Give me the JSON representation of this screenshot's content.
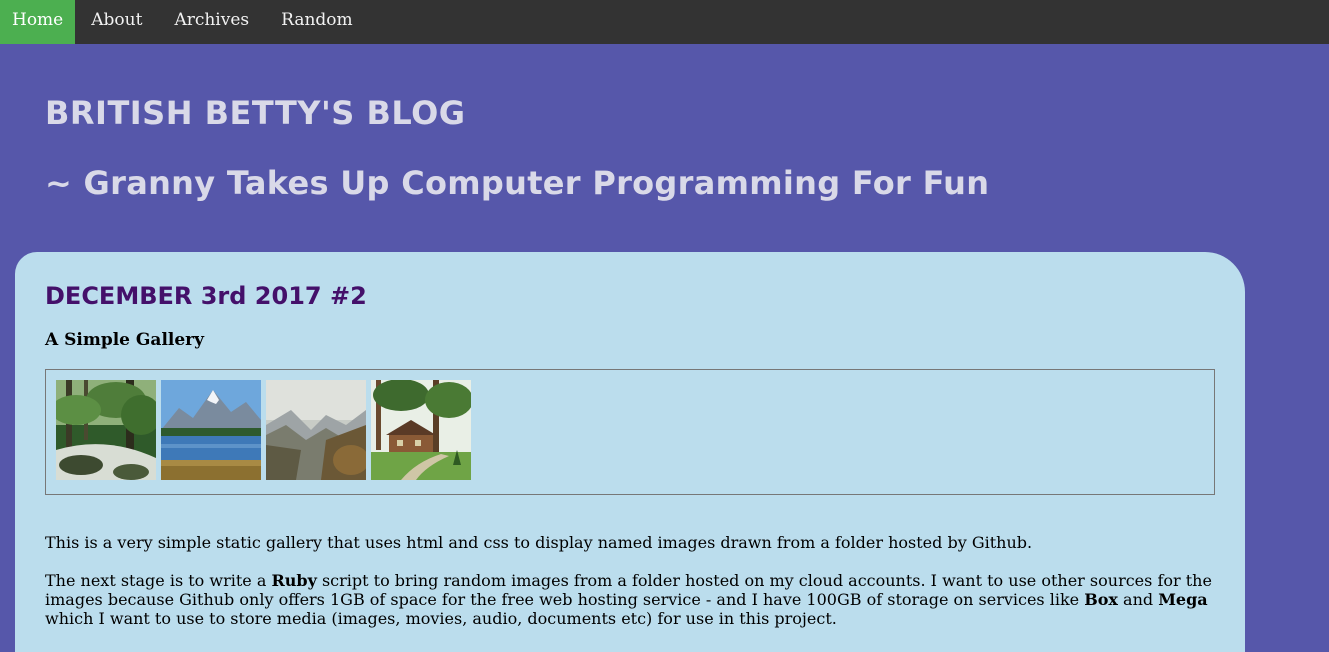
{
  "nav": {
    "items": [
      {
        "label": "Home",
        "active": true
      },
      {
        "label": "About",
        "active": false
      },
      {
        "label": "Archives",
        "active": false
      },
      {
        "label": "Random",
        "active": false
      }
    ]
  },
  "header": {
    "title": "BRITISH BETTY'S BLOG",
    "tagline": "~ Granny Takes Up Computer Programming For Fun"
  },
  "post": {
    "date": "DECEMBER 3rd 2017 #2",
    "subtitle": "A Simple Gallery",
    "gallery": [
      {
        "name": "forest-stream"
      },
      {
        "name": "mountain-lake"
      },
      {
        "name": "mountain-valley"
      },
      {
        "name": "log-cabin"
      }
    ],
    "para1": "This is a very simple static gallery that uses html and css to display named images drawn from a folder hosted by Github.",
    "para2": {
      "a": "The next stage is to write a ",
      "b1": "Ruby",
      "c": " script to bring random images from a folder hosted on my cloud accounts. I want to use other sources for the images because Github only offers 1GB of space for the free web hosting service - and I have 100GB of storage on services like ",
      "b2": "Box",
      "d": " and ",
      "b3": "Mega",
      "e": " which I want to use to store media (images, movies, audio, documents etc) for use in this project."
    }
  },
  "colors": {
    "nav_bg": "#333333",
    "nav_active": "#4caf50",
    "page_bg": "#5657aa",
    "card_bg": "#bbdded",
    "date_color": "#44106a"
  }
}
